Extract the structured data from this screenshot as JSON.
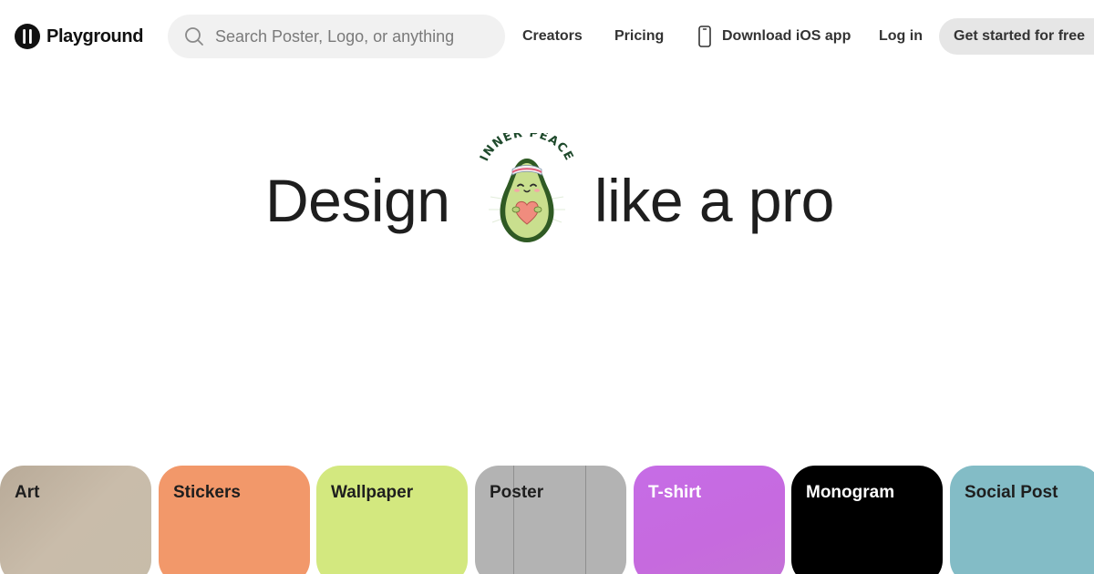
{
  "brand": {
    "name": "Playground",
    "icon": "playground-logo-icon"
  },
  "search": {
    "placeholder": "Search Poster, Logo, or anything",
    "value": "",
    "icon": "search-icon"
  },
  "nav": {
    "creators": "Creators",
    "pricing": "Pricing",
    "ios_app": "Download iOS app",
    "ios_icon": "phone-icon",
    "login": "Log in",
    "cta": "Get started for free"
  },
  "hero": {
    "left_word": "Design",
    "right_words": "like a pro",
    "sticker_text": "INNER PEACE",
    "sticker_icon": "avocado-sticker-icon"
  },
  "categories": [
    {
      "label": "Art",
      "color": "#c3b6a4"
    },
    {
      "label": "Stickers",
      "color": "#f2986a"
    },
    {
      "label": "Wallpaper",
      "color": "#d3e87f"
    },
    {
      "label": "Poster",
      "color": "#b3b3b3"
    },
    {
      "label": "T-shirt",
      "color": "#c66ce6"
    },
    {
      "label": "Monogram",
      "color": "#000000"
    },
    {
      "label": "Social Post",
      "color": "#83bcc6"
    }
  ]
}
